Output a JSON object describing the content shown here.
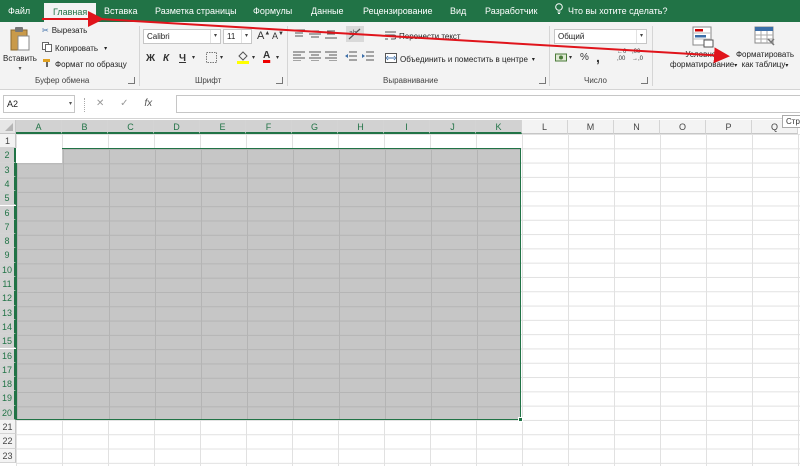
{
  "tabs": [
    {
      "label": "Файл",
      "active": false
    },
    {
      "label": "Главная",
      "active": true
    },
    {
      "label": "Вставка",
      "active": false
    },
    {
      "label": "Разметка страницы",
      "active": false
    },
    {
      "label": "Формулы",
      "active": false
    },
    {
      "label": "Данные",
      "active": false
    },
    {
      "label": "Рецензирование",
      "active": false
    },
    {
      "label": "Вид",
      "active": false
    },
    {
      "label": "Разработчик",
      "active": false
    }
  ],
  "tell_me": "Что вы хотите сделать?",
  "clipboard": {
    "paste_label": "Вставить",
    "cut_label": "Вырезать",
    "copy_label": "Копировать",
    "format_painter_label": "Формат по образцу",
    "group_label": "Буфер обмена"
  },
  "font": {
    "name": "Calibri",
    "size": "11",
    "bold": "Ж",
    "italic": "К",
    "underline": "Ч",
    "grow": "A",
    "shrink": "A",
    "font_color_letter": "A",
    "group_label": "Шрифт"
  },
  "alignment": {
    "wrap_label": "Перенести текст",
    "merge_label": "Объединить и поместить в центре",
    "group_label": "Выравнивание"
  },
  "number": {
    "format": "Общий",
    "group_label": "Число"
  },
  "styles": {
    "conditional_label_1": "Условное",
    "conditional_label_2": "форматирование",
    "table_label_1": "Форматировать",
    "table_label_2": "как таблицу"
  },
  "tooltip_stub": "Стр",
  "name_box": "A2",
  "formula_icons": {
    "cancel": "✕",
    "enter": "✓",
    "fx": "fx"
  },
  "columns": [
    "A",
    "B",
    "C",
    "D",
    "E",
    "F",
    "G",
    "H",
    "I",
    "J",
    "K",
    "L",
    "M",
    "N",
    "O",
    "P",
    "Q"
  ],
  "rows": [
    "1",
    "2",
    "3",
    "4",
    "5",
    "6",
    "7",
    "8",
    "9",
    "10",
    "11",
    "12",
    "13",
    "14",
    "15",
    "16",
    "17",
    "18",
    "19",
    "20",
    "21",
    "22",
    "23"
  ],
  "selection": {
    "range": "A2:K20",
    "selected_columns": [
      "A",
      "B",
      "C",
      "D",
      "E",
      "F",
      "G",
      "H",
      "I",
      "J",
      "K"
    ]
  },
  "colors": {
    "accent": "#217346",
    "selection_fill": "#c6c6c6",
    "arrow": "#e0141b"
  }
}
